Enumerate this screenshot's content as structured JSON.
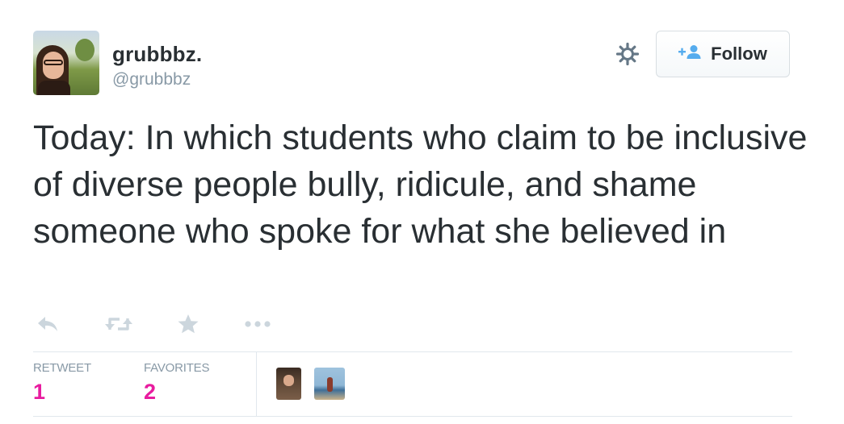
{
  "user": {
    "display_name": "grubbbz.",
    "handle": "@grubbbz"
  },
  "header": {
    "follow_label": "Follow"
  },
  "tweet": {
    "text": "Today: In which students who claim to be inclusive of diverse people bully, ridicule, and shame someone who spoke for what she believed in"
  },
  "stats": {
    "retweet_label": "RETWEET",
    "retweet_count": "1",
    "favorites_label": "FAVORITES",
    "favorites_count": "2"
  },
  "icons": [
    "gear-icon",
    "follow-person-icon",
    "reply-icon",
    "retweet-icon",
    "favorite-star-icon",
    "more-icon"
  ],
  "colors": {
    "accent_pink": "#e81c9f",
    "icon_gray": "#ccd6dd",
    "follow_blue": "#55acee",
    "text": "#292f33",
    "muted": "#8899a6"
  }
}
